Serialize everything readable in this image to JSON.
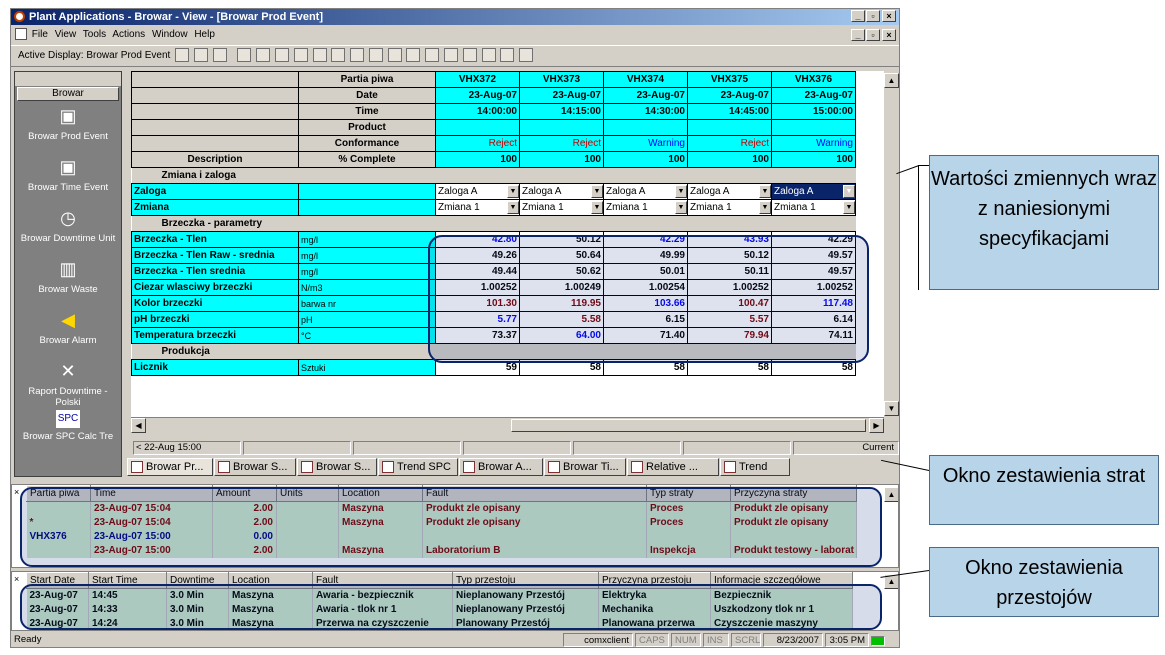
{
  "title": "Plant Applications - Browar - View - [Browar Prod Event]",
  "menu": [
    "File",
    "View",
    "Tools",
    "Actions",
    "Window",
    "Help"
  ],
  "active_display": "Active Display: Browar Prod Event",
  "sidebar": {
    "group": "Browar",
    "items": [
      {
        "label": "Browar Prod Event",
        "icon": "prod-event-icon"
      },
      {
        "label": "Browar Time Event",
        "icon": "time-event-icon"
      },
      {
        "label": "Browar Downtime Unit",
        "icon": "clock-icon"
      },
      {
        "label": "Browar Waste",
        "icon": "trash-icon"
      },
      {
        "label": "Browar Alarm",
        "icon": "speaker-icon"
      },
      {
        "label": "Raport Downtime - Polski",
        "icon": "report-icon"
      },
      {
        "label": "Browar SPC Calc Tre",
        "icon": "spc-icon"
      }
    ]
  },
  "grid": {
    "header_rows": [
      {
        "label": "Partia piwa",
        "values": [
          "VHX372",
          "VHX373",
          "VHX374",
          "VHX375",
          "VHX376"
        ]
      },
      {
        "label": "Date",
        "values": [
          "23-Aug-07",
          "23-Aug-07",
          "23-Aug-07",
          "23-Aug-07",
          "23-Aug-07"
        ]
      },
      {
        "label": "Time",
        "values": [
          "14:00:00",
          "14:15:00",
          "14:30:00",
          "14:45:00",
          "15:00:00"
        ]
      },
      {
        "label": "Product",
        "values": [
          "",
          "",
          "",
          "",
          ""
        ]
      },
      {
        "label": "Conformance",
        "values": [
          "Reject",
          "Reject",
          "Warning",
          "Reject",
          "Warning"
        ]
      },
      {
        "label": "% Complete",
        "values": [
          "100",
          "100",
          "100",
          "100",
          "100"
        ]
      }
    ],
    "description_label": "Description",
    "section1": "Zmiana i zaloga",
    "dropdown_rows": [
      {
        "label": "Zaloga",
        "values": [
          "Zaloga A",
          "Zaloga A",
          "Zaloga A",
          "Zaloga A",
          "Zaloga A"
        ]
      },
      {
        "label": "Zmiana",
        "values": [
          "Zmiana 1",
          "Zmiana 1",
          "Zmiana 1",
          "Zmiana 1",
          "Zmiana 1"
        ]
      }
    ],
    "section2": "Brzeczka - parametry",
    "param_rows": [
      {
        "label": "Brzeczka - Tlen",
        "unit": "mg/l",
        "values": [
          "42.80",
          "50.12",
          "42.29",
          "43.93",
          "42.29"
        ],
        "colors": [
          "blue",
          "",
          "blue",
          "blue",
          ""
        ]
      },
      {
        "label": "Brzeczka - Tlen Raw - srednia",
        "unit": "mg/l",
        "values": [
          "49.26",
          "50.64",
          "49.99",
          "50.12",
          "49.57"
        ],
        "colors": [
          "",
          "",
          "",
          "",
          ""
        ]
      },
      {
        "label": "Brzeczka - Tlen srednia",
        "unit": "mg/l",
        "values": [
          "49.44",
          "50.62",
          "50.01",
          "50.11",
          "49.57"
        ],
        "colors": [
          "",
          "",
          "",
          "",
          ""
        ]
      },
      {
        "label": "Ciezar wlasciwy brzeczki",
        "unit": "N/m3",
        "values": [
          "1.00252",
          "1.00249",
          "1.00254",
          "1.00252",
          "1.00252"
        ],
        "colors": [
          "",
          "",
          "",
          "",
          ""
        ]
      },
      {
        "label": "Kolor brzeczki",
        "unit": "barwa nr",
        "values": [
          "101.30",
          "119.95",
          "103.66",
          "100.47",
          "117.48"
        ],
        "colors": [
          "red",
          "red",
          "blue",
          "red",
          "blue"
        ]
      },
      {
        "label": "pH brzeczki",
        "unit": "pH",
        "values": [
          "5.77",
          "5.58",
          "6.15",
          "5.57",
          "6.14"
        ],
        "colors": [
          "blue",
          "red",
          "",
          "red",
          ""
        ]
      },
      {
        "label": "Temperatura brzeczki",
        "unit": "°C",
        "values": [
          "73.37",
          "64.00",
          "71.40",
          "79.94",
          "74.11"
        ],
        "colors": [
          "",
          "blue",
          "",
          "red",
          ""
        ]
      }
    ],
    "section3": "Produkcja",
    "counter_row": {
      "label": "Licznik",
      "unit": "Sztuki",
      "values": [
        "59",
        "58",
        "58",
        "58",
        "58"
      ]
    }
  },
  "timeline": {
    "start": "< 22-Aug 15:00",
    "end": "Current"
  },
  "tabs": [
    "Browar Pr...",
    "Browar S...",
    "Browar S...",
    "Trend SPC",
    "Browar A...",
    "Browar Ti...",
    "Relative ...",
    "Trend"
  ],
  "losses": {
    "headers": [
      "Partia piwa",
      "Time",
      "Amount",
      "Units",
      "Location",
      "Fault",
      "Typ straty",
      "Przyczyna straty"
    ],
    "rows": [
      {
        "partia": "",
        "time": "23-Aug-07 15:04",
        "amount": "2.00",
        "units": "",
        "location": "Maszyna",
        "fault": "Produkt zle opisany",
        "typ": "Proces",
        "przyczyna": "Produkt zle opisany"
      },
      {
        "partia": "*",
        "time": "23-Aug-07 15:04",
        "amount": "2.00",
        "units": "",
        "location": "Maszyna",
        "fault": "Produkt zle opisany",
        "typ": "Proces",
        "przyczyna": "Produkt zle opisany"
      },
      {
        "partia": "VHX376",
        "time": "23-Aug-07 15:00",
        "amount": "0.00",
        "units": "",
        "location": "",
        "fault": "",
        "typ": "",
        "przyczyna": ""
      },
      {
        "partia": "",
        "time": "23-Aug-07 15:00",
        "amount": "2.00",
        "units": "",
        "location": "Maszyna",
        "fault": "Laboratorium B",
        "typ": "Inspekcja",
        "przyczyna": "Produkt testowy - laborat"
      }
    ]
  },
  "downtime": {
    "headers": [
      "Start Date",
      "Start Time",
      "Downtime",
      "Location",
      "Fault",
      "Typ przestoju",
      "Przyczyna przestoju",
      "Informacje szczegółowe"
    ],
    "rows": [
      {
        "date": "23-Aug-07",
        "time": "14:45",
        "dt": "3.0 Min",
        "loc": "Maszyna",
        "fault": "Awaria - bezpiecznik",
        "typ": "Nieplanowany Przestój",
        "przyczyna": "Elektryka",
        "info": "Bezpiecznik"
      },
      {
        "date": "23-Aug-07",
        "time": "14:33",
        "dt": "3.0 Min",
        "loc": "Maszyna",
        "fault": "Awaria - tlok nr 1",
        "typ": "Nieplanowany Przestój",
        "przyczyna": "Mechanika",
        "info": "Uszkodzony tlok nr 1"
      },
      {
        "date": "23-Aug-07",
        "time": "14:24",
        "dt": "3.0 Min",
        "loc": "Maszyna",
        "fault": "Przerwa na czyszczenie",
        "typ": "Planowany Przestój",
        "przyczyna": "Planowana przerwa",
        "info": "Czyszczenie maszyny"
      }
    ]
  },
  "status": {
    "ready": "Ready",
    "client": "comxclient",
    "caps": "CAPS",
    "num": "NUM",
    "ins": "INS",
    "scrl": "SCRL",
    "date": "8/23/2007",
    "time": "3:05 PM"
  },
  "callouts": {
    "values": "Wartości zmiennych wraz z naniesionymi specyfikacjami",
    "losses": "Okno zestawienia strat",
    "downtime": "Okno zestawienia przestojów"
  },
  "colors": {
    "cyan": "#00ffff",
    "title": "#0a246a",
    "callout": "#b8d4e8",
    "reject": "#c00000",
    "warning": "#0000ff",
    "loss_text": "#800000",
    "downtime_row": "#cce8cc"
  }
}
